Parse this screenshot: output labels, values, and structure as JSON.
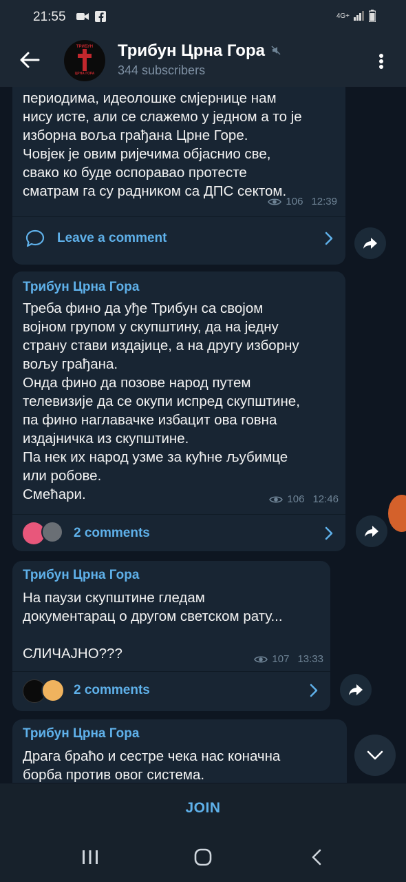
{
  "status_bar": {
    "time": "21:55",
    "network": "4G+"
  },
  "header": {
    "title": "Трибун Црна Гора",
    "subscribers": "344 subscribers",
    "avatar_top": "ТРИБУН",
    "avatar_bottom": "ЦРНА ГОРА"
  },
  "messages": [
    {
      "text": "периодима, идеолошке смјернице нам\nнису исте, али се слажемо у једном а то је\nизборна воља грађана Црне Горе.\nЧовјек је овим ријечима објаснио све,\nсвако ко буде оспоравао протесте\nсматрам га су радником са ДПС сектом.",
      "views": "106",
      "time": "12:39",
      "comments": "Leave a comment"
    },
    {
      "author": "Трибун Црна Гора",
      "text": "Треба фино да уђе Трибун са својом\nвојном групом у скупштину, да на једну\nстрану стави издајице, а на другу изборну\nвољу грађана.\nОнда фино да позове народ путем\nтелевизије да се окупи испред скупштине,\nпа фино наглавачке избацит ова говна\nиздајничка из скупштине.\nПа нек их народ узме за кућне љубимце\nили робове.\nСмећари.",
      "views": "106",
      "time": "12:46",
      "comments": "2 comments"
    },
    {
      "author": "Трибун Црна Гора",
      "text": "На паузи скупштине гледам\nдокументарац о другом светском рату...\n\nСЛИЧАЈНО???",
      "views": "107",
      "time": "13:33",
      "comments": "2 comments"
    },
    {
      "author": "Трибун Црна Гора",
      "text": "Драга браћо и сестре чека нас коначна\nборба против овог система."
    }
  ],
  "join_label": "JOIN",
  "icons": {
    "back": "arrow-left-icon",
    "mute": "mute-icon",
    "menu": "more-vert-icon",
    "views": "eye-icon",
    "comment": "comment-icon",
    "share": "share-icon",
    "chevron": "chevron-right-icon",
    "scroll": "chevron-down-icon"
  },
  "colors": {
    "accent": "#5fb1ea",
    "bubble": "#182533",
    "background": "#0e1621",
    "header": "#1c2733"
  }
}
